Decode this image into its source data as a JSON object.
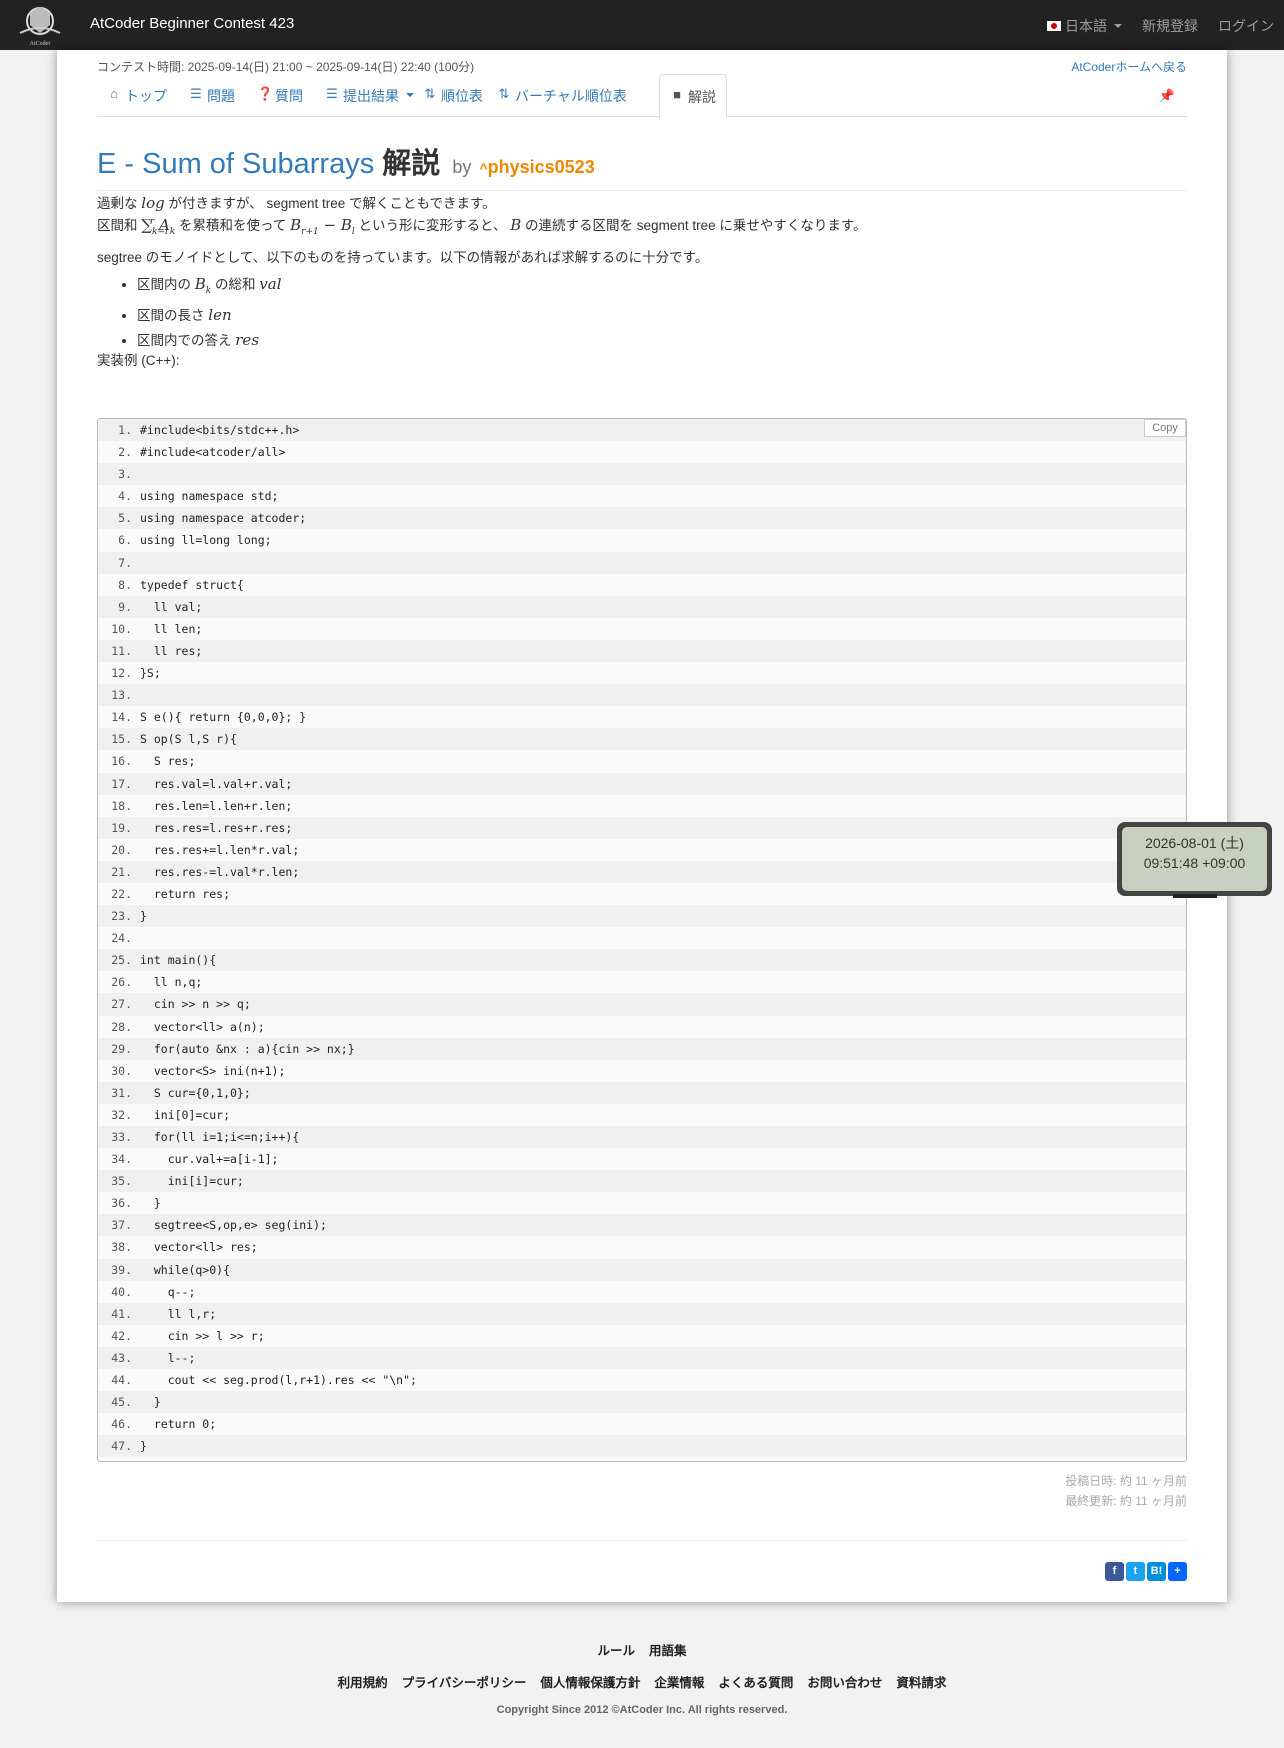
{
  "navbar": {
    "brand": "AtCoder Beginner Contest 423",
    "logo_text": "AtCoder",
    "language": "日本語",
    "signup": "新規登録",
    "login": "ログイン"
  },
  "contest": {
    "time": "コンテスト時間: 2025-09-14(日) 21:00 ~ 2025-09-14(日) 22:40 (100分)",
    "home_link": "AtCoderホームへ戻る"
  },
  "tabs": [
    {
      "label": "トップ",
      "icon": "home-icon"
    },
    {
      "label": "問題",
      "icon": "list-icon"
    },
    {
      "label": "質問",
      "icon": "question-icon"
    },
    {
      "label": "提出結果",
      "icon": "list-icon"
    },
    {
      "label": "順位表",
      "icon": "sort-icon"
    },
    {
      "label": "バーチャル順位表",
      "icon": "sort-icon"
    },
    {
      "label": "解説",
      "icon": "book-icon"
    }
  ],
  "title": {
    "problem": "E - Sum of Subarrays",
    "suffix": "解説",
    "by": "by",
    "user": "physics0523"
  },
  "body": {
    "p1": "過剰な",
    "p1_math": "log",
    "p1_rest": "が付きますが、 segment tree で解くこともできます。",
    "p2_a": "区間和",
    "p2_sum": "∑_{k=l}^{r} A_k",
    "p2_b": "を累積和を使って",
    "p2_expr": "B_{r+1} − B_l",
    "p2_c": "という形に変形すると、",
    "p2_B": "B",
    "p2_d": "の連続する区間を segment tree に乗せやすくなります。",
    "p3": "segtree のモノイドとして、以下のものを持っています。以下の情報があれば求解するのに十分です。",
    "bullets": [
      {
        "text": "区間内の",
        "math": "B_k",
        "text2": "の総和",
        "math2": "val"
      },
      {
        "text": "区間の長さ",
        "math": "len"
      },
      {
        "text": "区間内での答え",
        "math": "res"
      }
    ],
    "impl_label": "実装例 (C++):"
  },
  "code": {
    "copy_label": "Copy",
    "lines": [
      "#include<bits/stdc++.h>",
      "#include<atcoder/all>",
      "",
      "using namespace std;",
      "using namespace atcoder;",
      "using ll=long long;",
      "",
      "typedef struct{",
      "  ll val;",
      "  ll len;",
      "  ll res;",
      "}S;",
      "",
      "S e(){ return {0,0,0}; }",
      "S op(S l,S r){",
      "  S res;",
      "  res.val=l.val+r.val;",
      "  res.len=l.len+r.len;",
      "  res.res=l.res+r.res;",
      "  res.res+=l.len*r.val;",
      "  res.res-=l.val*r.len;",
      "  return res;",
      "}",
      "",
      "int main(){",
      "  ll n,q;",
      "  cin >> n >> q;",
      "  vector<ll> a(n);",
      "  for(auto &nx : a){cin >> nx;}",
      "  vector<S> ini(n+1);",
      "  S cur={0,1,0};",
      "  ini[0]=cur;",
      "  for(ll i=1;i<=n;i++){",
      "    cur.val+=a[i-1];",
      "    ini[i]=cur;",
      "  }",
      "  segtree<S,op,e> seg(ini);",
      "  vector<ll> res;",
      "  while(q>0){",
      "    q--;",
      "    ll l,r;",
      "    cin >> l >> r;",
      "    l--;",
      "    cout << seg.prod(l,r+1).res << \"\\n\";",
      "  }",
      "  return 0;",
      "}"
    ]
  },
  "meta": {
    "posted": "投稿日時: 約 11 ヶ月前",
    "updated": "最終更新: 約 11 ヶ月前"
  },
  "clock": {
    "date": "2026-08-01 (土)",
    "time": "09:51:48 +09:00"
  },
  "share": [
    "f",
    "t",
    "B!",
    "+"
  ],
  "footer": {
    "row1": [
      "ルール",
      "用語集"
    ],
    "row2": [
      "利用規約",
      "プライバシーポリシー",
      "個人情報保護方針",
      "企業情報",
      "よくある質問",
      "お問い合わせ",
      "資料請求"
    ],
    "copyright": "Copyright Since 2012 ©AtCoder Inc. All rights reserved."
  },
  "colors": {
    "navbar": "#222222",
    "link": "#337ab7",
    "user": "#ee8800"
  }
}
